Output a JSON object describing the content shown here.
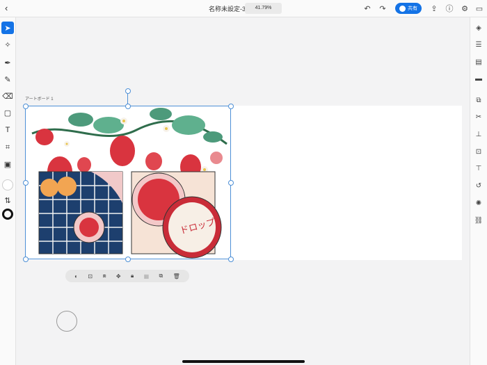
{
  "topbar": {
    "back_icon": "chevron-left-icon",
    "title": "名称未設定-3",
    "zoom": "41.79%",
    "share_label": "共有",
    "icons": [
      "undo-icon",
      "redo-icon",
      "export-icon",
      "help-icon",
      "settings-icon",
      "present-icon"
    ]
  },
  "artboard": {
    "label": "アートボード 1"
  },
  "left_tools": [
    "select-icon",
    "magic-wand-icon",
    "pen-icon",
    "brush-icon",
    "eraser-icon",
    "shape-icon",
    "text-icon",
    "crop-icon",
    "image-icon",
    "fill-color-icon",
    "swap-icon",
    "stroke-color-icon"
  ],
  "right_tools": [
    "layers-icon",
    "properties-icon",
    "libraries-icon",
    "comments-icon",
    "arrange-icon",
    "repeat-icon",
    "align-icon",
    "transform-icon",
    "path-icon",
    "distort-icon",
    "effects-icon",
    "link-icon"
  ],
  "action_bar": [
    "mask-icon",
    "resize-icon",
    "group-icon",
    "move-icon",
    "lock-icon",
    "duplicate-disabled-icon",
    "copy-icon",
    "delete-icon"
  ],
  "colors": {
    "accent": "#1473e6",
    "selection": "#4d8fd6"
  }
}
